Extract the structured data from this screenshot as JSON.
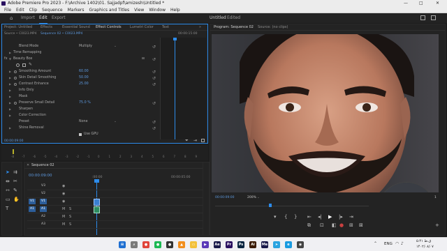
{
  "window": {
    "title": "Adobe Premiere Pro 2023 - F:\\Archive 1402\\01. Sajjadpf\\amizesh\\Untitled *",
    "controls": [
      "—",
      "□",
      "✕"
    ]
  },
  "menu": [
    "File",
    "Edit",
    "Clip",
    "Sequence",
    "Markers",
    "Graphics and Titles",
    "View",
    "Window",
    "Help"
  ],
  "workspace": {
    "tabs": [
      "Import",
      "Edit",
      "Export"
    ],
    "active": "Edit",
    "project_name": "Untitled",
    "status": "Edited"
  },
  "left_panel": {
    "tabs": [
      "Project: Untitled",
      "Effects",
      "Essential Sound",
      "Effect Controls",
      "Lumetri Color",
      "Text"
    ],
    "active_tab": "Effect Controls",
    "source_label": "Source • C0023.MP4",
    "sequence_label": "Sequence 02 • C0023.MP4",
    "timecode_top": "00:00:15:00",
    "effect_name": "Beauty Box",
    "rows": [
      {
        "label": "Blend Mode",
        "value": "Multiply",
        "type": "dropdown"
      },
      {
        "label": "Time Remapping",
        "value": "",
        "type": "group"
      },
      {
        "label": "Beauty Box",
        "value": "",
        "type": "effect"
      },
      {
        "label": "Smoothing Amount",
        "value": "60.00",
        "type": "param"
      },
      {
        "label": "Skin Detail Smoothing",
        "value": "50.00",
        "type": "param"
      },
      {
        "label": "Contrast Enhance",
        "value": "25.00",
        "type": "param"
      },
      {
        "label": "Info Only",
        "value": "",
        "type": "group"
      },
      {
        "label": "Mask",
        "value": "",
        "type": "group"
      },
      {
        "label": "Preserve Small Detail",
        "value": "75.0 %",
        "type": "param"
      },
      {
        "label": "Sharpen",
        "value": "",
        "type": "group"
      },
      {
        "label": "Color Correction",
        "value": "",
        "type": "group"
      },
      {
        "label": "Preset",
        "value": "None",
        "type": "dropdown"
      },
      {
        "label": "Shine Removal",
        "value": "",
        "type": "group"
      },
      {
        "label": "Use GPU",
        "value": "",
        "type": "checkbox"
      }
    ],
    "timecode_bottom": "00:00:09:00",
    "ruler": [
      "-8",
      "-7",
      "-6",
      "-5",
      "-4",
      "-3",
      "-2",
      "-1",
      "0",
      "1",
      "2",
      "3",
      "4",
      "5",
      "6",
      "7",
      "8",
      "9"
    ]
  },
  "program_monitor": {
    "tabs": [
      "Program: Sequence 02",
      "Source: (no clips)"
    ],
    "timecode": "00:00:09:00",
    "zoom": "200%",
    "duration_fragment": "1",
    "timeline_position": 0.35
  },
  "timeline": {
    "tab": "Sequence 02",
    "timecode": "00:00:09:00",
    "ruler": [
      ":00:00",
      "00:00:05:00"
    ],
    "video_tracks": [
      "V3",
      "V2",
      "V1"
    ],
    "audio_tracks": [
      "A1",
      "A2",
      "A3"
    ]
  },
  "taskbar": {
    "lang": "ENG",
    "time": "۵:۴۱ ق.ظ",
    "date": "۱۴۰۲/۰۸/۰۷",
    "icons": [
      {
        "name": "windows-icon",
        "color": "#1f6fd1",
        "text": "⊞"
      },
      {
        "name": "search-icon",
        "color": "#7a7a7a",
        "text": "⌕"
      },
      {
        "name": "chrome-icon",
        "color": "#e0443a",
        "text": "●"
      },
      {
        "name": "spotify-icon",
        "color": "#1db954",
        "text": "●"
      },
      {
        "name": "obs-icon",
        "color": "#333333",
        "text": "●"
      },
      {
        "name": "vlc-icon",
        "color": "#f28e1c",
        "text": "▲"
      },
      {
        "name": "explorer-icon",
        "color": "#f3c13a",
        "text": "▭"
      },
      {
        "name": "media-icon",
        "color": "#5a39b8",
        "text": "▶"
      },
      {
        "name": "ae-icon",
        "color": "#1a1a4a",
        "text": "Ae"
      },
      {
        "name": "pr-icon",
        "color": "#2a1060",
        "text": "Pr"
      },
      {
        "name": "ps-icon",
        "color": "#0a2540",
        "text": "Ps"
      },
      {
        "name": "ai-icon",
        "color": "#3a1a00",
        "text": "Ai"
      },
      {
        "name": "me-icon",
        "color": "#1a1a4a",
        "text": "Me"
      },
      {
        "name": "telegram-icon",
        "color": "#2aa3e0",
        "text": "➤"
      },
      {
        "name": "edge-icon",
        "color": "#1a9be0",
        "text": "e"
      },
      {
        "name": "davinci-icon",
        "color": "#444444",
        "text": "◉"
      }
    ]
  }
}
